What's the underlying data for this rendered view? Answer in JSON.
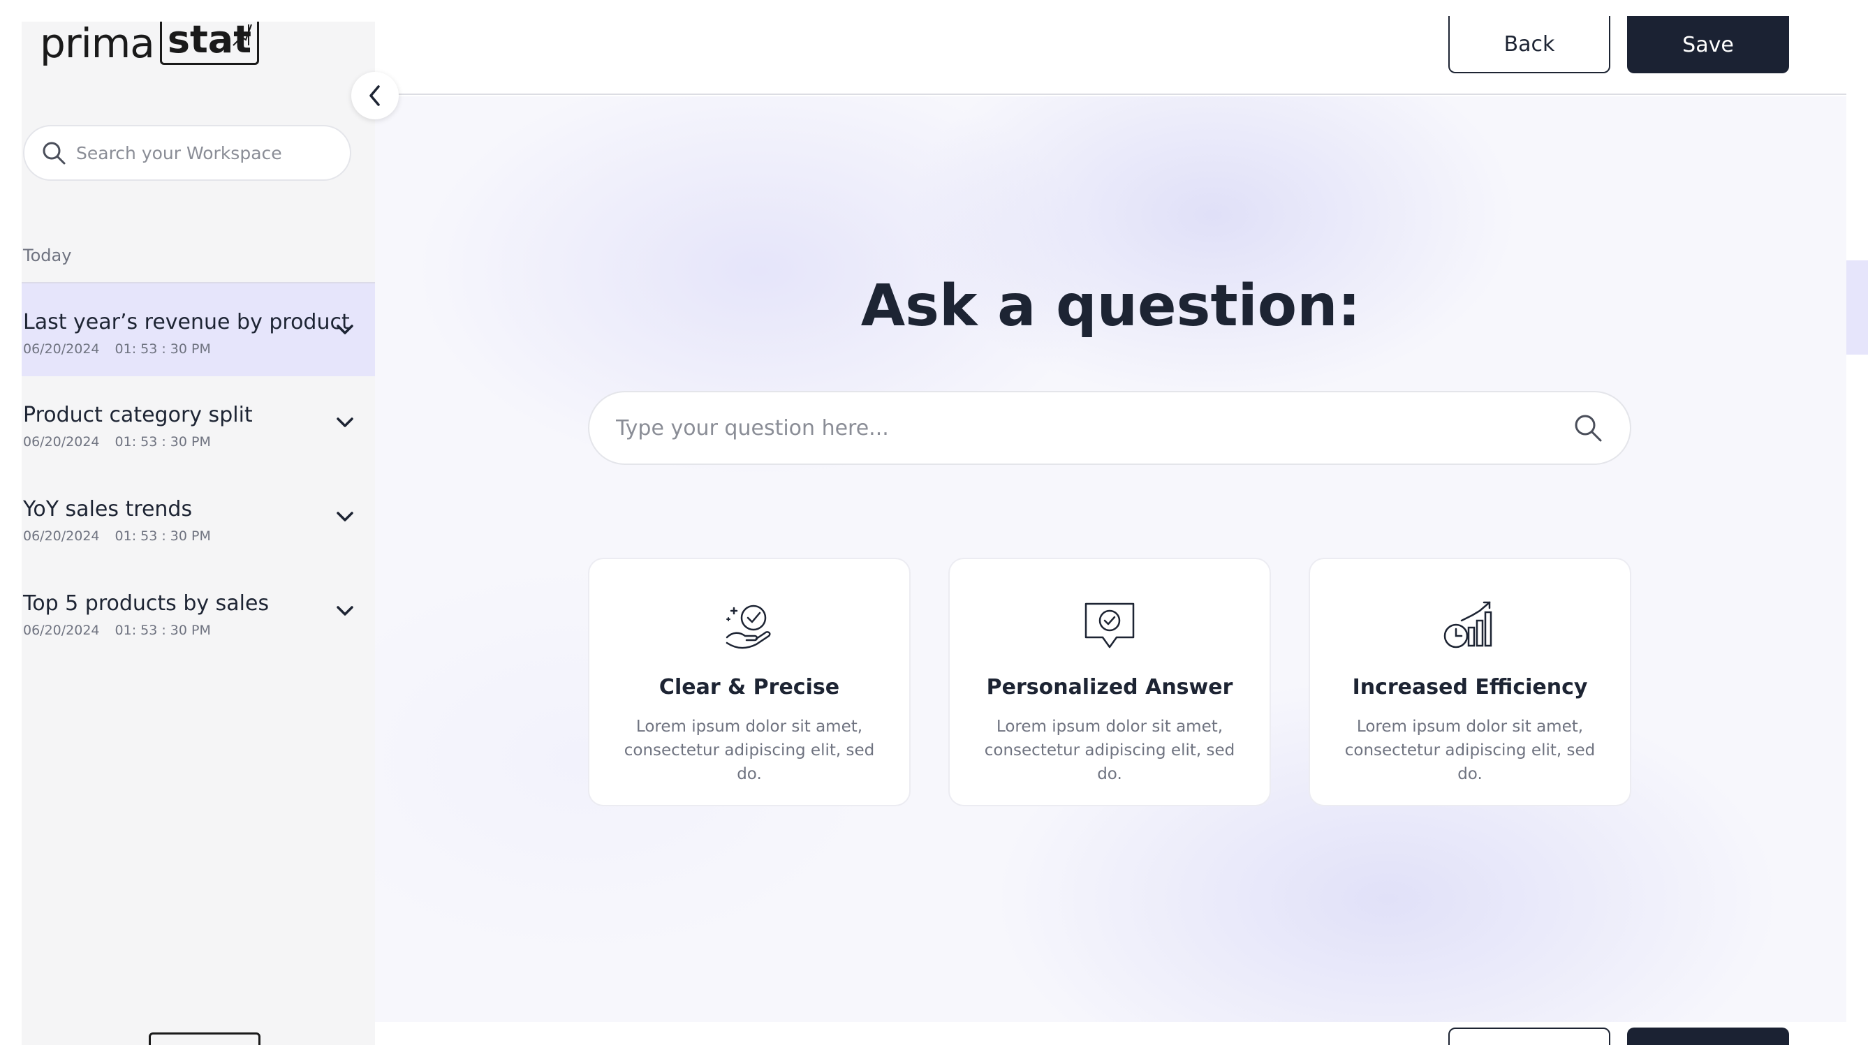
{
  "brand": {
    "logo_left": "prima",
    "logo_right": "stat"
  },
  "sidebar": {
    "search_placeholder": "Search your Workspace",
    "section_label": "Today",
    "items": [
      {
        "title": "Last year’s revenue by product",
        "date": "06/20/2024",
        "time": "01: 53 : 30 PM",
        "active": true
      },
      {
        "title": "Product category split",
        "date": "06/20/2024",
        "time": "01: 53 : 30 PM",
        "active": false
      },
      {
        "title": "YoY sales trends",
        "date": "06/20/2024",
        "time": "01: 53 : 30 PM",
        "active": false
      },
      {
        "title": "Top 5 products by sales",
        "date": "06/20/2024",
        "time": "01: 53 : 30 PM",
        "active": false
      }
    ]
  },
  "toolbar": {
    "back_label": "Back",
    "save_label": "Save"
  },
  "main": {
    "heading": "Ask a question:",
    "question_placeholder": "Type your question here...",
    "cards": [
      {
        "icon": "hand-check-icon",
        "title": "Clear & Precise",
        "desc": "Lorem ipsum dolor sit amet, consectetur adipiscing elit, sed do."
      },
      {
        "icon": "chat-check-icon",
        "title": "Personalized Answer",
        "desc": "Lorem ipsum dolor sit amet, consectetur adipiscing elit, sed do."
      },
      {
        "icon": "clock-chart-icon",
        "title": "Increased Efficiency",
        "desc": "Lorem ipsum dolor sit amet, consectetur adipiscing elit, sed do."
      }
    ]
  },
  "colors": {
    "primary": "#1b2233",
    "active_bg": "#e6e5fb",
    "sidebar_bg": "#f5f5f6",
    "muted_text": "#6f7380"
  }
}
